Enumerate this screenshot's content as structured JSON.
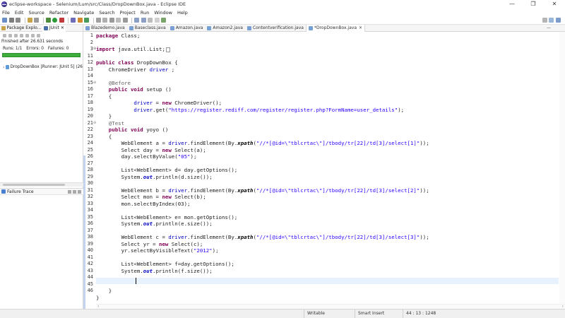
{
  "window": {
    "title": "eclipse-workspace - Selenium/Lum/src/Class/DropDownBox.java - Eclipse IDE",
    "minimize": "—",
    "maximize": "❐",
    "close": "✕"
  },
  "menu": [
    "File",
    "Edit",
    "Source",
    "Refactor",
    "Navigate",
    "Search",
    "Project",
    "Run",
    "Window",
    "Help"
  ],
  "left_tabs": [
    {
      "label": "Package Explo...",
      "close": ""
    },
    {
      "label": "JUnit",
      "close": "✕"
    }
  ],
  "junit": {
    "finished": "Finished after 26.631 seconds",
    "runs": "Runs: 1/1",
    "errors": "Errors: 0",
    "failures": "Failures: 0",
    "success_fraction": 1.0,
    "tree_item": "DropDownBox [Runner: JUnit 5] (26",
    "failure_trace": "Failure Trace"
  },
  "editor_tabs": [
    {
      "label": "Blazedemo.java",
      "active": false
    },
    {
      "label": "Baseclass.java",
      "active": false
    },
    {
      "label": "Amazon.java",
      "active": false
    },
    {
      "label": "Amazon2.java",
      "active": false
    },
    {
      "label": "Contentverification.java",
      "active": false
    },
    {
      "label": "*DropDownBox.java",
      "active": true
    }
  ],
  "editor_tab_close": "✕",
  "editor_tab_menu": "—",
  "line_numbers": [
    "1",
    "2",
    "3",
    "11",
    "12",
    "13",
    "14",
    "15",
    "16",
    "17",
    "18",
    "19",
    "20",
    "21",
    "22",
    "23",
    "24",
    "25",
    "26",
    "27",
    "28",
    "29",
    "30",
    "31",
    "32",
    "33",
    "34",
    "35",
    "36",
    "37",
    "38",
    "39",
    "40",
    "41",
    "42",
    "43",
    "44",
    "45",
    "46"
  ],
  "fold_markers": {
    "3": "⊕",
    "15": "⊖",
    "21": "⊖"
  },
  "code": {
    "l1": {
      "kw": "package",
      "rest": " Class;"
    },
    "l3": {
      "kw": "import",
      "rest": " java.util.List;"
    },
    "l12": {
      "kw1": "public",
      "kw2": "class",
      "rest": " DropDownBox {"
    },
    "l13": {
      "text": "    ChromeDriver ",
      "field": "driver",
      "rest": " ;"
    },
    "l15": {
      "ann": "    @Before"
    },
    "l16": {
      "kw1": "    public",
      "kw2": "void",
      "rest": " setup ()"
    },
    "l17": {
      "text": "    {"
    },
    "l18": {
      "pre": "            ",
      "field": "driver",
      "mid": " = ",
      "kw": "new",
      "rest": " ChromeDriver();"
    },
    "l19": {
      "pre": "            ",
      "field": "driver",
      "mid": ".get(",
      "str": "\"https://register.rediff.com/register/register.php?FormName=user_details\"",
      "rest": ");"
    },
    "l20": {
      "text": "    }"
    },
    "l21": {
      "ann": "    @Test"
    },
    "l22": {
      "kw1": "    public",
      "kw2": "void",
      "rest": " yoyo ()"
    },
    "l23": {
      "text": "    {"
    },
    "l24": {
      "pre": "        WebElement a = ",
      "field": "driver",
      "mid": ".findElement(By.",
      "ital": "xpath",
      "p2": "(",
      "str": "\"//*[@id=\\\"tblcrtac\\\"]/tbody/tr[22]/td[3]/select[1]\"",
      "rest": "));"
    },
    "l25": {
      "pre": "        Select day = ",
      "kw": "new",
      "rest": " Select(a);"
    },
    "l26": {
      "pre": "        day.selectByValue(",
      "str": "\"05\"",
      "rest": ");"
    },
    "l28": {
      "text": "        List<WebElement> d= day.getOptions();"
    },
    "l29": {
      "pre": "        System.",
      "ital": "out",
      "rest": ".println(d.size());"
    },
    "l31": {
      "pre": "        WebElement b = ",
      "field": "driver",
      "mid": ".findElement(By.",
      "ital": "xpath",
      "p2": "(",
      "str": "\"//*[@id=\\\"tblcrtac\\\"]/tbody/tr[22]/td[3]/select[2]\"",
      "rest": "));"
    },
    "l32": {
      "pre": "        Select mon = ",
      "kw": "new",
      "rest": " Select(b);"
    },
    "l33": {
      "text": "        mon.selectByIndex(03);"
    },
    "l35": {
      "text": "        List<WebElement> e= mon.getOptions();"
    },
    "l36": {
      "pre": "        System.",
      "ital": "out",
      "rest": ".println(e.size());"
    },
    "l38": {
      "pre": "        WebElement c = ",
      "field": "driver",
      "mid": ".findElement(By.",
      "ital": "xpath",
      "p2": "(",
      "str": "\"//*[@id=\\\"tblcrtac\\\"]/tbody/tr[22]/td[3]/select[3]\"",
      "rest": "));"
    },
    "l39": {
      "pre": "        Select yr = ",
      "kw": "new",
      "rest": " Select(c);"
    },
    "l40": {
      "pre": "        yr.selectByVisibleText(",
      "str": "\"2012\"",
      "rest": ");"
    },
    "l42": {
      "text": "        List<WebElement> f=day.getOptions();"
    },
    "l43": {
      "pre": "        System.",
      "ital": "out",
      "rest": ".println(f.size());"
    },
    "l45": {
      "text": "    }"
    },
    "l46": {
      "text": "}"
    }
  },
  "status": {
    "writable": "Writable",
    "insert_mode": "Smart Insert",
    "position": "44 : 13 : 1248"
  },
  "colors": {
    "keyword": "#7f0055",
    "string": "#2a00ff",
    "field": "#0000c0",
    "annotation": "#646464",
    "junit_success": "#3cae3c"
  }
}
